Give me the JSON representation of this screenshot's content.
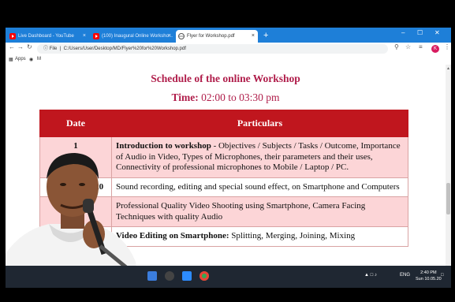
{
  "browser": {
    "tabs": [
      {
        "label": "Live Dashboard - YouTube",
        "close": "×"
      },
      {
        "label": "(100) Inaugural Online Worksho...",
        "close": "×"
      },
      {
        "label": "Flyer for Workshop.pdf",
        "close": "×"
      }
    ],
    "new_tab": "+",
    "url_prefix": "File",
    "url": "C:/Users/User/Desktop/MD/Flyer%20for%20Workshop.pdf",
    "bookmarks": [
      {
        "label": "Apps"
      },
      {
        "label": "M"
      }
    ],
    "profile_initial": "K"
  },
  "document": {
    "title": "Schedule of the online Workshop",
    "time_label": "Time:",
    "time_value": "02:00 to 03:30 pm",
    "table": {
      "headers": [
        "Date",
        "Particulars"
      ],
      "rows": [
        {
          "date": "1",
          "bold": "Introduction to workshop",
          "text": " - Objectives / Subjects / Tasks / Outcome, Importance of Audio in Video, Types of Microphones, their parameters and their uses, Connectivity of professional microphones to Mobile / Laptop / PC."
        },
        {
          "date": "11th June 2020",
          "bold": "",
          "text": "Sound recording, editing and special sound effect, on Smartphone and Computers"
        },
        {
          "date": "",
          "bold": "",
          "text": "Professional Quality Video Shooting using Smartphone, Camera Facing Techniques with quality Audio"
        },
        {
          "date": "",
          "bold": "Video Editing on Smartphone:",
          "text": " Splitting, Merging, Joining, Mixing"
        }
      ]
    }
  },
  "taskbar": {
    "tray_text": "ENG",
    "time": "2:40 PM",
    "date": "Sun 10.05.20"
  },
  "colors": {
    "accent": "#b01e4b",
    "header_bg": "#c0161e",
    "row_pink": "#fcd5d7",
    "tab_strip": "#1e7fd8"
  }
}
